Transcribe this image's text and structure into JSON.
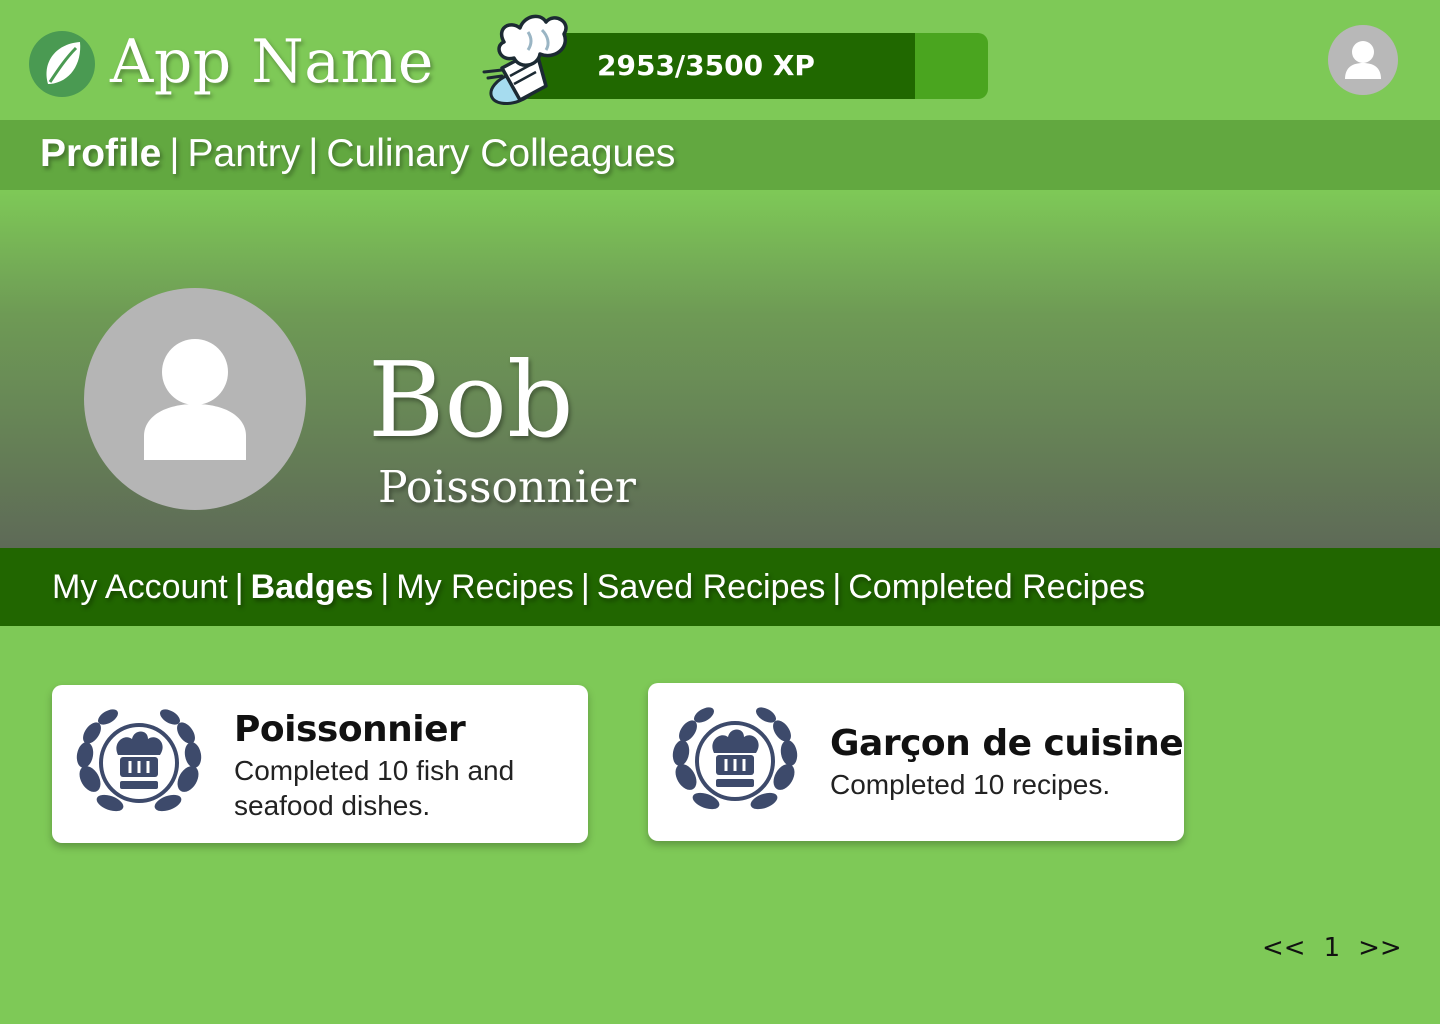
{
  "header": {
    "app_name": "App Name",
    "xp_text": "2953/3500 XP",
    "xp_current": 2953,
    "xp_max": 3500
  },
  "main_nav": {
    "items": [
      {
        "label": "Profile",
        "active": true
      },
      {
        "label": "Pantry",
        "active": false
      },
      {
        "label": "Culinary Colleagues",
        "active": false
      }
    ],
    "separator": "|"
  },
  "profile": {
    "name": "Bob",
    "rank": "Poissonnier"
  },
  "sub_nav": {
    "items": [
      {
        "label": "My Account",
        "active": false
      },
      {
        "label": "Badges",
        "active": true
      },
      {
        "label": "My Recipes",
        "active": false
      },
      {
        "label": "Saved Recipes",
        "active": false
      },
      {
        "label": "Completed Recipes",
        "active": false
      }
    ],
    "separator": "|"
  },
  "badges": [
    {
      "title": "Poissonnier",
      "description": "Completed 10 fish and seafood dishes.",
      "icon": "chef-hat-laurel-icon"
    },
    {
      "title": "Garçon de cuisine",
      "description": "Completed 10 recipes.",
      "icon": "chef-hat-laurel-icon"
    }
  ],
  "pagination": {
    "prev": "<<",
    "page": "1",
    "next": ">>"
  },
  "colors": {
    "background": "#7ec957",
    "main_nav_bg": "#62a840",
    "sub_nav_bg": "#216600",
    "xp_fill": "#206800",
    "xp_track": "#4aa51f",
    "badge_icon": "#3d4a6b"
  }
}
